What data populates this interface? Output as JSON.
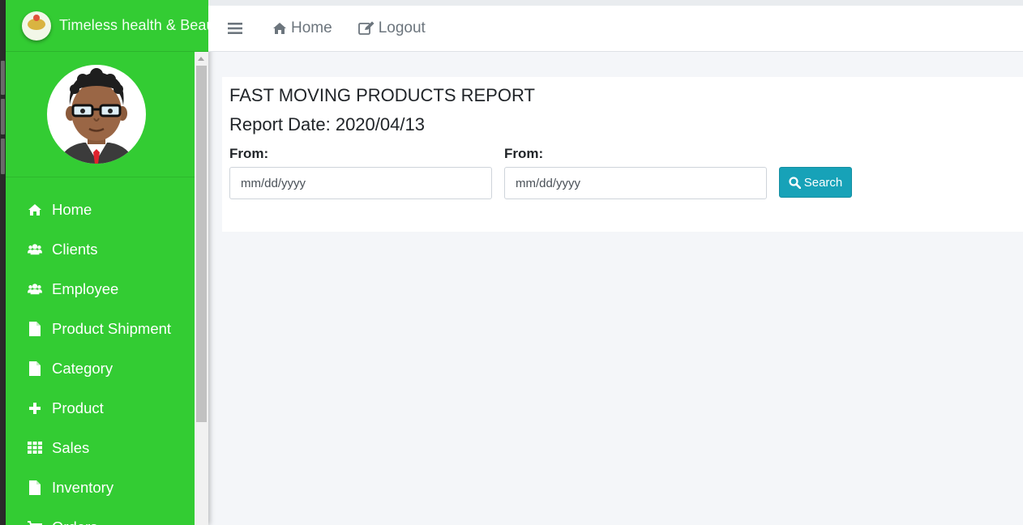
{
  "brand": {
    "name": "Timeless health & Beau",
    "colors": {
      "sidebar": "#33cc33",
      "accent": "#17a2b8"
    }
  },
  "topbar": {
    "menu_icon": "hamburger-icon",
    "home_label": "Home",
    "logout_label": "Logout"
  },
  "sidebar": {
    "items": [
      {
        "label": "Home",
        "icon": "home-icon"
      },
      {
        "label": "Clients",
        "icon": "users-icon"
      },
      {
        "label": "Employee",
        "icon": "users-icon"
      },
      {
        "label": "Product Shipment",
        "icon": "file-icon"
      },
      {
        "label": "Category",
        "icon": "file-icon"
      },
      {
        "label": "Product",
        "icon": "plus-icon"
      },
      {
        "label": "Sales",
        "icon": "grid-icon"
      },
      {
        "label": "Inventory",
        "icon": "file-icon"
      },
      {
        "label": "Orders",
        "icon": "cart-icon"
      }
    ]
  },
  "report": {
    "title": "FAST MOVING PRODUCTS REPORT",
    "date_line": "Report Date: 2020/04/13",
    "from_label_1": "From:",
    "from_label_2": "From:",
    "date_placeholder_1": "mm/dd/yyyy",
    "date_placeholder_2": "mm/dd/yyyy",
    "search_label": "Search"
  }
}
